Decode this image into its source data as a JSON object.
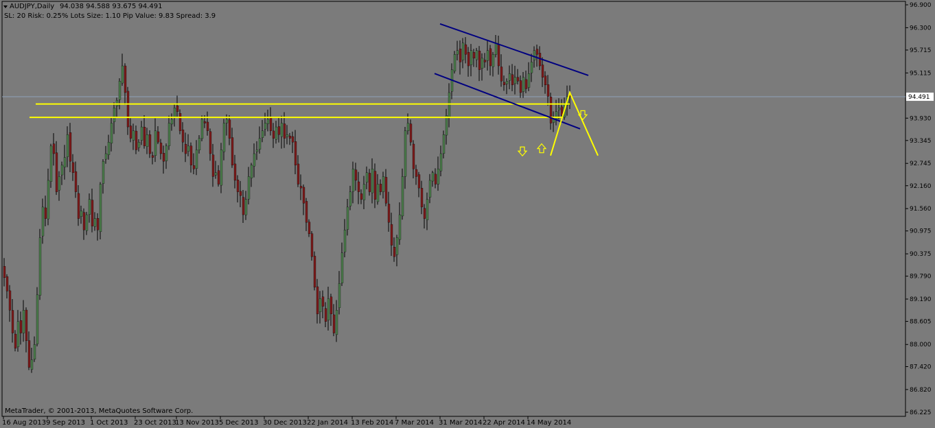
{
  "header": {
    "symbol": "AUDJPY,Daily",
    "ohlc": "94.038 94.588 93.675 94.491",
    "info": "SL: 20 Risk: 0.25%  Lots Size: 1.10 Pip Value: 9.83 Spread: 3.9"
  },
  "footer": {
    "copyright": "MetaTrader, © 2001-2013, MetaQuotes Software Corp."
  },
  "colors": {
    "background": "#7b7b7b",
    "bull_candle": "#4a7a4a",
    "bear_candle": "#7a1a1a",
    "wick": "#000000",
    "yellow": "#ffff00",
    "channel": "#000080",
    "price_line": "#8fa0b8",
    "price_label_bg": "#ffffff"
  },
  "chart_data": {
    "type": "candlestick",
    "symbol": "AUDJPY",
    "timeframe": "Daily",
    "ylim": [
      86.225,
      96.9
    ],
    "y_ticks": [
      "96.900",
      "96.300",
      "95.715",
      "95.115",
      "94.491",
      "93.930",
      "93.345",
      "92.745",
      "92.160",
      "91.560",
      "90.975",
      "90.375",
      "89.790",
      "89.190",
      "88.605",
      "88.000",
      "87.420",
      "86.820",
      "86.225"
    ],
    "current_price": "94.491",
    "x_ticks": [
      {
        "label": "16 Aug 2013",
        "index": 0
      },
      {
        "label": "9 Sep 2013",
        "index": 16
      },
      {
        "label": "1 Oct 2013",
        "index": 32
      },
      {
        "label": "23 Oct 2013",
        "index": 48
      },
      {
        "label": "13 Nov 2013",
        "index": 63
      },
      {
        "label": "5 Dec 2013",
        "index": 79
      },
      {
        "label": "30 Dec 2013",
        "index": 95
      },
      {
        "label": "22 Jan 2014",
        "index": 111
      },
      {
        "label": "13 Feb 2014",
        "index": 127
      },
      {
        "label": "7 Mar 2014",
        "index": 143
      },
      {
        "label": "31 Mar 2014",
        "index": 159
      },
      {
        "label": "22 Apr 2014",
        "index": 175
      },
      {
        "label": "14 May 2014",
        "index": 191
      }
    ],
    "closes": [
      89.75,
      89.4,
      88.9,
      88.3,
      87.9,
      88.6,
      88.3,
      88.9,
      88.1,
      87.4,
      87.6,
      88.0,
      89.3,
      90.8,
      91.6,
      91.3,
      92.3,
      93.2,
      93.0,
      92.0,
      92.4,
      92.7,
      92.9,
      93.5,
      92.8,
      92.5,
      92.0,
      91.3,
      91.5,
      91.0,
      91.4,
      91.8,
      91.1,
      91.3,
      91.0,
      92.2,
      92.8,
      93.0,
      93.3,
      93.8,
      94.2,
      94.4,
      94.9,
      95.3,
      94.6,
      93.7,
      93.4,
      93.6,
      93.1,
      93.3,
      93.7,
      93.2,
      93.5,
      93.0,
      92.9,
      93.6,
      93.3,
      93.0,
      92.8,
      93.2,
      93.8,
      93.9,
      94.2,
      94.1,
      93.6,
      93.3,
      93.0,
      93.2,
      92.7,
      92.6,
      93.1,
      93.4,
      93.9,
      93.8,
      93.6,
      93.0,
      92.4,
      92.5,
      92.2,
      93.1,
      93.8,
      93.9,
      93.4,
      92.7,
      92.3,
      92.0,
      91.9,
      91.4,
      91.8,
      92.4,
      92.7,
      93.0,
      93.1,
      93.4,
      93.6,
      93.8,
      93.9,
      93.6,
      93.4,
      93.7,
      93.5,
      93.8,
      93.4,
      93.5,
      93.4,
      93.3,
      92.7,
      92.2,
      92.1,
      91.7,
      91.2,
      90.9,
      90.3,
      89.5,
      88.8,
      89.2,
      89.0,
      88.6,
      89.2,
      88.8,
      88.3,
      88.9,
      89.6,
      90.4,
      91.0,
      91.6,
      92.0,
      92.6,
      92.3,
      92.0,
      91.8,
      92.2,
      92.5,
      92.0,
      92.6,
      91.8,
      92.2,
      92.0,
      92.4,
      91.7,
      91.2,
      90.6,
      90.3,
      90.8,
      91.4,
      92.4,
      93.6,
      93.8,
      93.3,
      92.6,
      92.4,
      92.1,
      91.6,
      91.3,
      91.8,
      92.3,
      92.5,
      92.2,
      92.6,
      93.0,
      93.5,
      94.0,
      94.6,
      95.2,
      95.6,
      95.7,
      95.4,
      95.9,
      95.6,
      95.3,
      95.7,
      95.5,
      95.7,
      95.2,
      95.5,
      95.4,
      95.7,
      95.3,
      95.6,
      95.9,
      95.3,
      94.9,
      94.8,
      94.9,
      95.1,
      94.8,
      95.0,
      94.9,
      94.6,
      95.0,
      94.7,
      95.1,
      95.4,
      95.7,
      95.6,
      95.3,
      95.0,
      94.8,
      94.5,
      93.8,
      93.9,
      94.1,
      94.2,
      94.0,
      94.3,
      94.5,
      94.491
    ],
    "annotations": {
      "horizontal_levels": [
        94.3,
        93.95
      ],
      "channel": {
        "upper": [
          [
            159,
            96.4
          ],
          [
            213,
            95.05
          ]
        ],
        "lower": [
          [
            157,
            95.1
          ],
          [
            210,
            93.65
          ]
        ]
      },
      "arrows": [
        {
          "direction": "down",
          "index": 189,
          "price": 93.05
        },
        {
          "direction": "up",
          "index": 196,
          "price": 93.15
        },
        {
          "direction": "down",
          "index": 211,
          "price": 94.0
        }
      ]
    }
  }
}
